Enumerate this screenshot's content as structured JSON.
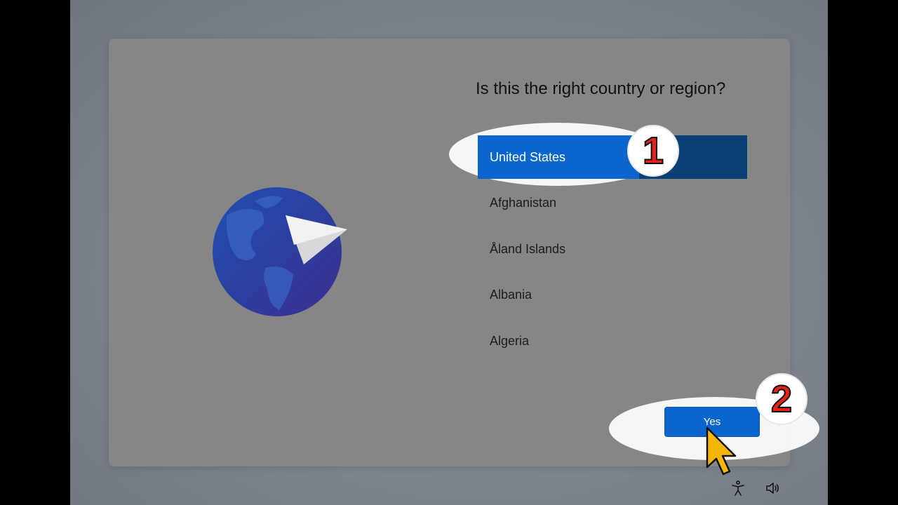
{
  "dialog": {
    "question": "Is this the right country or region?",
    "countries": [
      {
        "label": "United States",
        "selected": true
      },
      {
        "label": "Afghanistan",
        "selected": false
      },
      {
        "label": "Åland Islands",
        "selected": false
      },
      {
        "label": "Albania",
        "selected": false
      },
      {
        "label": "Algeria",
        "selected": false
      }
    ],
    "yes_label": "Yes"
  },
  "annotations": {
    "badge_1": "1",
    "badge_2": "2"
  },
  "tray": {
    "icons": [
      "accessibility-icon",
      "volume-icon"
    ]
  },
  "colors": {
    "accent": "#0a66cc",
    "selected_row": "#0a3f78",
    "badge_number": "#e2231a",
    "cursor": "#f2b705"
  }
}
